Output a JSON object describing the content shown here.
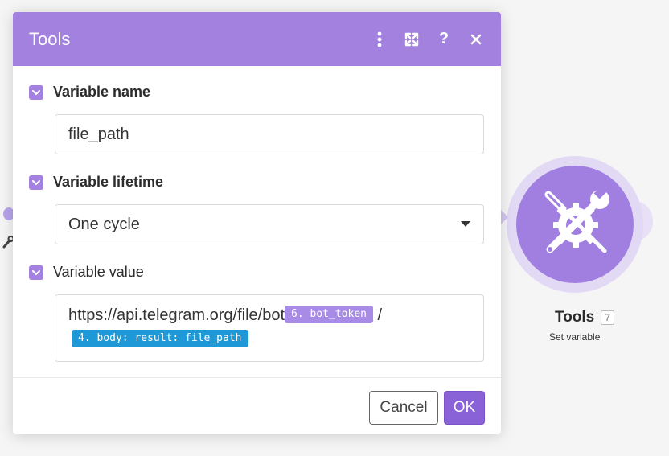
{
  "dialog": {
    "title": "Tools",
    "header_icons": [
      "more-vertical-icon",
      "expand-icon",
      "help-icon",
      "close-icon"
    ],
    "help_glyph": "?",
    "fields": {
      "variable_name": {
        "label": "Variable name",
        "value": "file_path"
      },
      "variable_lifetime": {
        "label": "Variable lifetime",
        "value": "One cycle"
      },
      "variable_value": {
        "label": "Variable value",
        "text": "https://api.telegram.org/file/bot",
        "pill1": "6. bot_token",
        "separator": "/",
        "pill2": "4. body: result: file_path"
      }
    },
    "buttons": {
      "cancel": "Cancel",
      "ok": "OK"
    }
  },
  "node": {
    "title": "Tools",
    "badge": "7",
    "subtitle": "Set variable",
    "icon": "tools-icon"
  },
  "colors": {
    "accent": "#a382df",
    "ok_button": "#8a62d8",
    "pill_purple": "#a88be6",
    "pill_blue": "#1f98d8",
    "node_circle": "#a07fe0"
  }
}
